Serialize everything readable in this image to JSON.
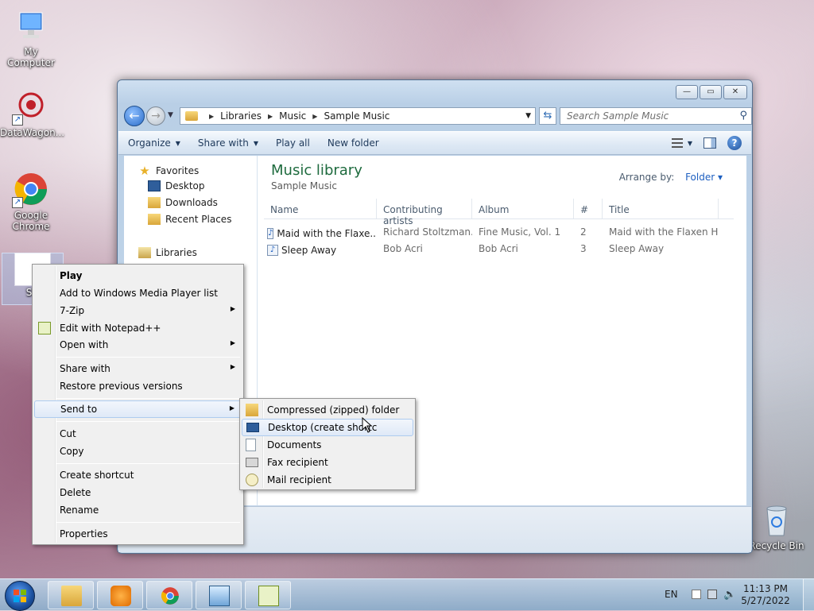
{
  "desktop": {
    "icons": [
      {
        "label": "My Computer"
      },
      {
        "label": "DataWagon..."
      },
      {
        "label": "Google Chrome"
      },
      {
        "label": "SU"
      },
      {
        "label": "Recycle Bin"
      }
    ]
  },
  "explorer": {
    "breadcrumb": [
      "Libraries",
      "Music",
      "Sample Music"
    ],
    "search_placeholder": "Search Sample Music",
    "toolbar": {
      "organize": "Organize",
      "share_with": "Share with",
      "play_all": "Play all",
      "new_folder": "New folder"
    },
    "nav": {
      "favorites": "Favorites",
      "desktop": "Desktop",
      "downloads": "Downloads",
      "recent_places": "Recent Places",
      "libraries": "Libraries"
    },
    "library_title": "Music library",
    "library_subtitle": "Sample Music",
    "arrange_label": "Arrange by:",
    "arrange_value": "Folder",
    "columns": [
      "Name",
      "Contributing artists",
      "Album",
      "#",
      "Title"
    ],
    "rows": [
      {
        "name": "Maid with the Flaxe...",
        "artists": "Richard Stoltzman...",
        "album": "Fine Music, Vol. 1",
        "num": "2",
        "title": "Maid with the Flaxen H..."
      },
      {
        "name": "Sleep Away",
        "artists": "Bob Acri",
        "album": "Bob Acri",
        "num": "3",
        "title": "Sleep Away"
      }
    ]
  },
  "context_menu": {
    "play": "Play",
    "add_wmp": "Add to Windows Media Player list",
    "zip7": "7-Zip",
    "notepadpp": "Edit with Notepad++",
    "open_with": "Open with",
    "share_with": "Share with",
    "restore": "Restore previous versions",
    "send_to": "Send to",
    "cut": "Cut",
    "copy": "Copy",
    "create_shortcut": "Create shortcut",
    "delete": "Delete",
    "rename": "Rename",
    "properties": "Properties"
  },
  "sendto_menu": {
    "compressed": "Compressed (zipped) folder",
    "desktop": "Desktop (create shortc",
    "documents": "Documents",
    "fax": "Fax recipient",
    "mail": "Mail recipient"
  },
  "taskbar": {
    "language": "EN",
    "time": "11:13 PM",
    "date": "5/27/2022"
  }
}
